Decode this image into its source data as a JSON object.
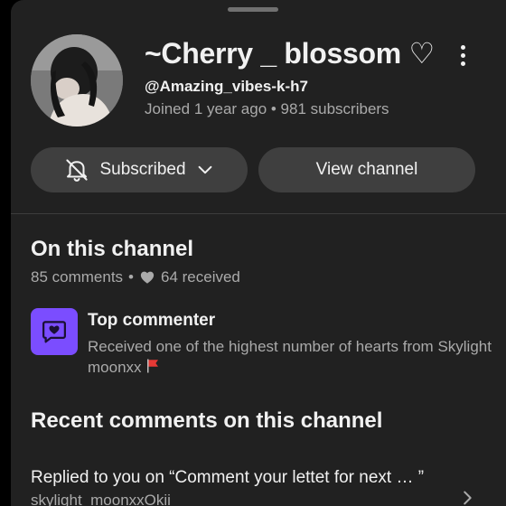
{
  "channel": {
    "name": "~Cherry _ blossom ♡",
    "handle": "@Amazing_vibes-k-h7",
    "meta": "Joined 1 year ago • 981 subscribers"
  },
  "buttons": {
    "subscribed_label": "Subscribed",
    "view_channel_label": "View channel"
  },
  "on_channel": {
    "title": "On this channel",
    "comments": "85 comments",
    "separator": "•",
    "received": "64 received"
  },
  "top_commenter": {
    "title": "Top commenter",
    "description": "Received one of the highest number of hearts from Skylight moonxx"
  },
  "recent": {
    "title": "Recent comments on this channel",
    "item_title": "Replied to you on “Comment your lettet for next … ”",
    "item_sub": "skylight_moonxxOkii"
  },
  "colors": {
    "background": "#000000",
    "sheet": "#212121",
    "button": "#3f3f3f",
    "badge": "#7b4dff",
    "secondary_text": "#aaaaaa"
  },
  "icons": [
    "more-vert-icon",
    "bell-off-icon",
    "chevron-down-icon",
    "heart-icon",
    "heart-message-icon",
    "red-flag-icon",
    "chevron-right-icon"
  ]
}
